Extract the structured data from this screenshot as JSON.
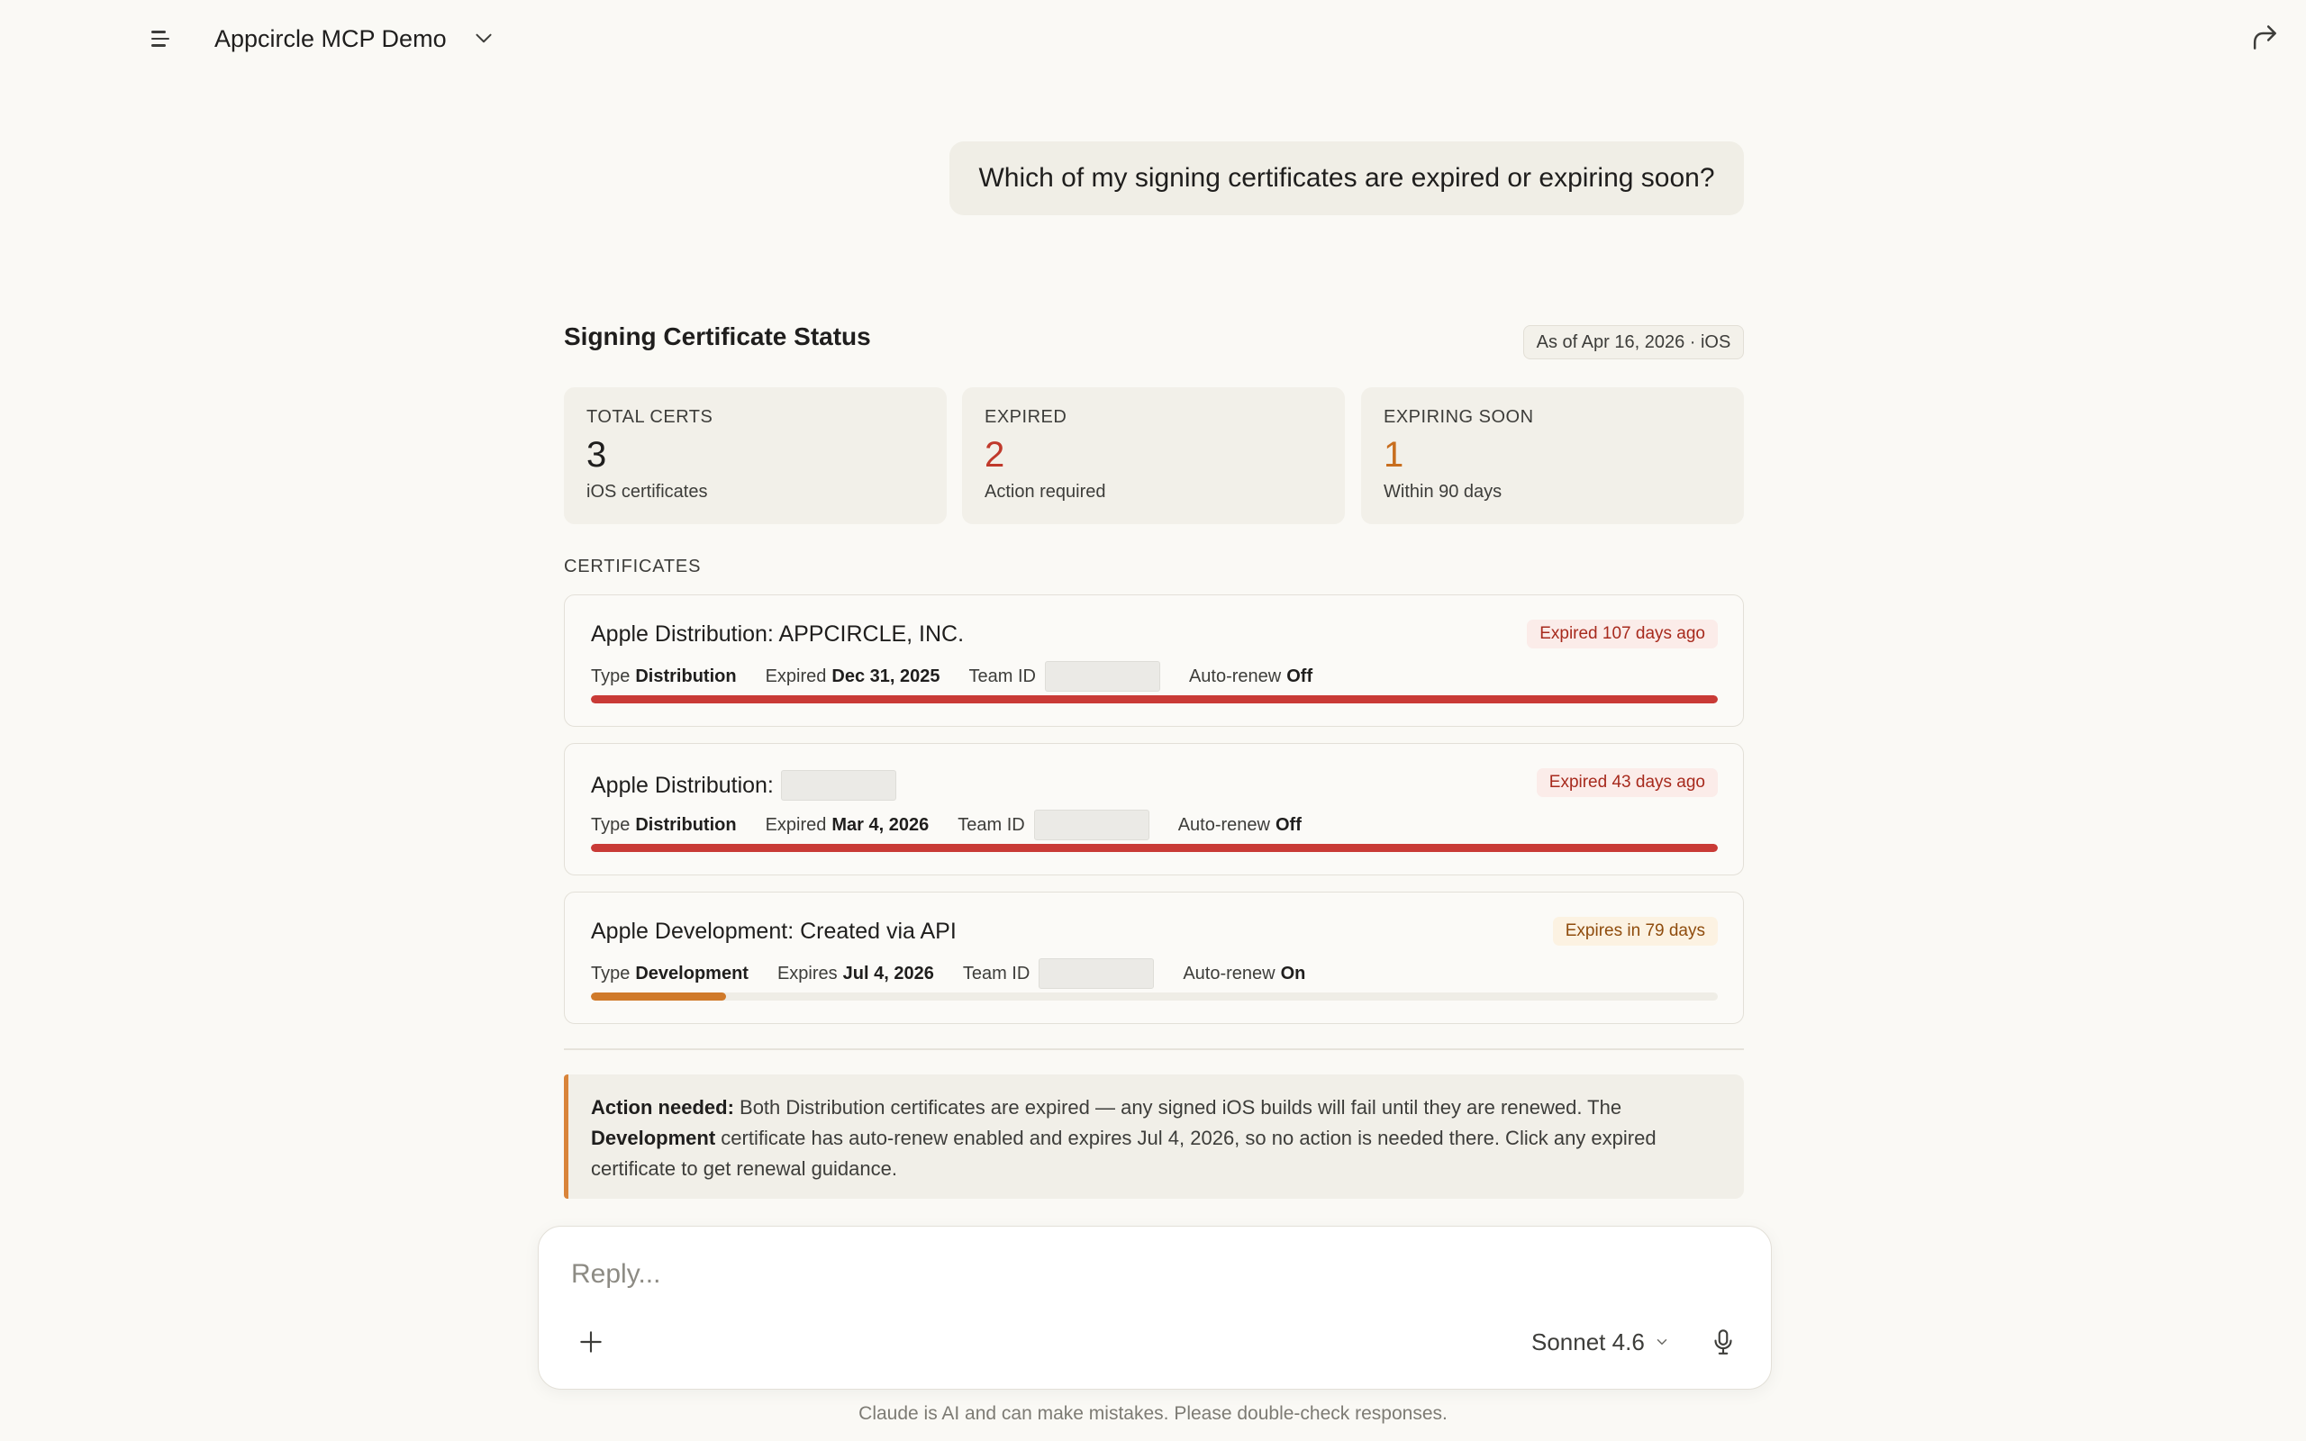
{
  "header": {
    "title": "Appcircle MCP Demo",
    "menu_icon": "menu-icon",
    "chevron_icon": "chevron-down-icon",
    "share_icon": "share-icon"
  },
  "user_message": "Which of my signing certificates are expired or expiring soon?",
  "status": {
    "title": "Signing Certificate Status",
    "as_of": "As of Apr 16, 2026 · iOS",
    "stats": [
      {
        "label": "TOTAL CERTS",
        "value": "3",
        "sub": "iOS certificates",
        "color": "#1f1e1d"
      },
      {
        "label": "EXPIRED",
        "value": "2",
        "sub": "Action required",
        "color": "#c0392b"
      },
      {
        "label": "EXPIRING SOON",
        "value": "1",
        "sub": "Within 90 days",
        "color": "#c86e1e"
      }
    ],
    "certificates_label": "CERTIFICATES",
    "certificates": [
      {
        "name": "Apple Distribution: APPCIRCLE, INC.",
        "badge": "Expired 107 days ago",
        "type_label": "Type",
        "type": "Distribution",
        "date_label": "Expired",
        "date": "Dec 31, 2025",
        "team_label": "Team ID",
        "renew_label": "Auto-renew",
        "renew": "Off",
        "progress": 1.0,
        "bar_color": "#c93a36"
      },
      {
        "name": "Apple Distribution:",
        "badge": "Expired 43 days ago",
        "type_label": "Type",
        "type": "Distribution",
        "date_label": "Expired",
        "date": "Mar 4, 2026",
        "team_label": "Team ID",
        "renew_label": "Auto-renew",
        "renew": "Off",
        "progress": 1.0,
        "bar_color": "#c93a36"
      },
      {
        "name": "Apple Development: Created via API",
        "badge": "Expires in 79 days",
        "type_label": "Type",
        "type": "Development",
        "date_label": "Expires",
        "date": "Jul 4, 2026",
        "team_label": "Team ID",
        "renew_label": "Auto-renew",
        "renew": "On",
        "progress": 0.12,
        "bar_color": "#d07a2a"
      }
    ],
    "callout": {
      "lead": "Action needed:",
      "text1": " Both Distribution certificates are expired — any signed iOS builds will fail until they are renewed. The ",
      "bold2": "Development",
      "text2": " certificate has auto-renew enabled and expires Jul 4, 2026, so no action is needed there. Click any expired certificate to get renewal guidance."
    }
  },
  "composer": {
    "placeholder": "Reply...",
    "model": "Sonnet 4.6",
    "plus_icon": "plus-icon",
    "mic_icon": "microphone-icon"
  },
  "disclaimer": "Claude is AI and can make mistakes. Please double-check responses."
}
